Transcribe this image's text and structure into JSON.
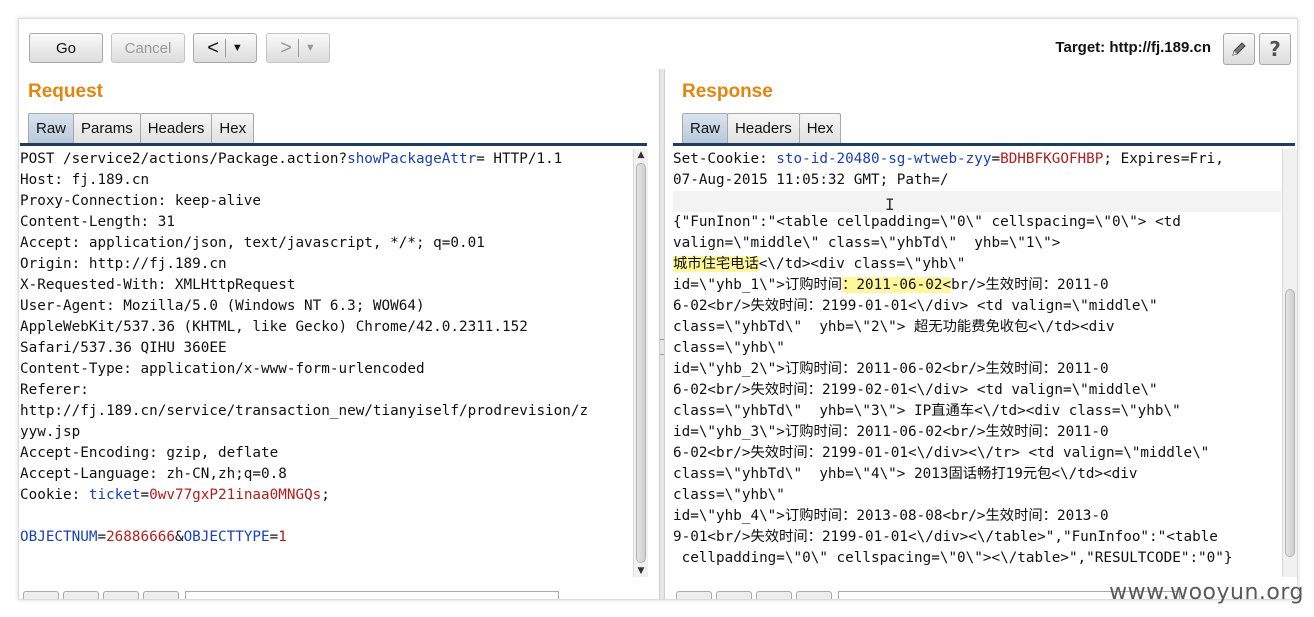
{
  "toolbar": {
    "go_label": "Go",
    "cancel_label": "Cancel",
    "back_glyph": "<",
    "forward_glyph": ">",
    "dropdown_glyph": "▼",
    "target_label": "Target: http://fj.189.cn",
    "edit_icon": "pencil-icon",
    "help_label": "?"
  },
  "request": {
    "title": "Request",
    "tabs": [
      "Raw",
      "Params",
      "Headers",
      "Hex"
    ],
    "active_tab": "Raw",
    "lines": [
      [
        {
          "t": "POST /service2/actions/Package.action?"
        },
        {
          "t": "showPackageAttr",
          "c": "blue"
        },
        {
          "t": "= HTTP/1.1"
        }
      ],
      [
        {
          "t": "Host: fj.189.cn"
        }
      ],
      [
        {
          "t": "Proxy-Connection: keep-alive"
        }
      ],
      [
        {
          "t": "Content-Length: 31"
        }
      ],
      [
        {
          "t": "Accept: application/json, text/javascript, */*; q=0.01"
        }
      ],
      [
        {
          "t": "Origin: http://fj.189.cn"
        }
      ],
      [
        {
          "t": "X-Requested-With: XMLHttpRequest"
        }
      ],
      [
        {
          "t": "User-Agent: Mozilla/5.0 (Windows NT 6.3; WOW64)"
        }
      ],
      [
        {
          "t": "AppleWebKit/537.36 (KHTML, like Gecko) Chrome/42.0.2311.152"
        }
      ],
      [
        {
          "t": "Safari/537.36 QIHU 360EE"
        }
      ],
      [
        {
          "t": "Content-Type: application/x-www-form-urlencoded"
        }
      ],
      [
        {
          "t": "Referer:"
        }
      ],
      [
        {
          "t": "http://fj.189.cn/service/transaction_new/tianyiself/prodrevision/z"
        }
      ],
      [
        {
          "t": "yyw.jsp"
        }
      ],
      [
        {
          "t": "Accept-Encoding: gzip, deflate"
        }
      ],
      [
        {
          "t": "Accept-Language: zh-CN,zh;q=0.8"
        }
      ],
      [
        {
          "t": "Cookie: "
        },
        {
          "t": "ticket",
          "c": "blue"
        },
        {
          "t": "="
        },
        {
          "t": "0wv77gxP21inaa0MNGQs",
          "c": "red"
        },
        {
          "t": ";"
        }
      ],
      [
        {
          "t": ""
        }
      ],
      [
        {
          "t": "OBJECTNUM",
          "c": "blue"
        },
        {
          "t": "="
        },
        {
          "t": "26886666",
          "c": "red"
        },
        {
          "t": "&"
        },
        {
          "t": "OBJECTTYPE",
          "c": "blue"
        },
        {
          "t": "="
        },
        {
          "t": "1",
          "c": "red"
        }
      ]
    ]
  },
  "response": {
    "title": "Response",
    "tabs": [
      "Raw",
      "Headers",
      "Hex"
    ],
    "active_tab": "Raw",
    "lines": [
      [
        {
          "t": "Set-Cookie: "
        },
        {
          "t": "sto-id-20480-sg-wtweb-zyy",
          "c": "blue"
        },
        {
          "t": "="
        },
        {
          "t": "BDHBFKGOFHBP",
          "c": "red"
        },
        {
          "t": "; Expires=Fri,"
        }
      ],
      [
        {
          "t": "07-Aug-2015 11:05:32 GMT; Path=/"
        }
      ],
      [
        {
          "t": ""
        }
      ],
      [
        {
          "t": "{\"FunInon\":\"<table cellpadding=\\\"0\\\" cellspacing=\\\"0\\\"> <td"
        }
      ],
      [
        {
          "t": "valign=\\\"middle\\\" class=\\\"yhbTd\\\"  yhb=\\\"1\\\">"
        }
      ],
      [
        {
          "t": "城市住宅电话",
          "c": "hl"
        },
        {
          "t": "<\\/td><div class=\\\"yhb\\\""
        }
      ],
      [
        {
          "t": "id=\\\"yhb_1\\\">订购时间"
        },
        {
          "t": "：2011-06-02<",
          "c": "hl"
        },
        {
          "t": "br/>生效时间：2011-0"
        }
      ],
      [
        {
          "t": "6-02<br/>失效时间：2199-01-01<\\/div> <td valign=\\\"middle\\\""
        }
      ],
      [
        {
          "t": "class=\\\"yhbTd\\\"  yhb=\\\"2\\\"> 超无功能费免收包<\\/td><div"
        }
      ],
      [
        {
          "t": "class=\\\"yhb\\\""
        }
      ],
      [
        {
          "t": "id=\\\"yhb_2\\\">订购时间：2011-06-02<br/>生效时间：2011-0"
        }
      ],
      [
        {
          "t": "6-02<br/>失效时间：2199-02-01<\\/div> <td valign=\\\"middle\\\""
        }
      ],
      [
        {
          "t": "class=\\\"yhbTd\\\"  yhb=\\\"3\\\"> IP直通车<\\/td><div class=\\\"yhb\\\""
        }
      ],
      [
        {
          "t": "id=\\\"yhb_3\\\">订购时间：2011-06-02<br/>生效时间：2011-0"
        }
      ],
      [
        {
          "t": "6-02<br/>失效时间：2199-01-01<\\/div><\\/tr> <td valign=\\\"middle\\\""
        }
      ],
      [
        {
          "t": "class=\\\"yhbTd\\\"  yhb=\\\"4\\\"> 2013固话畅打19元包<\\/td><div"
        }
      ],
      [
        {
          "t": "class=\\\"yhb\\\""
        }
      ],
      [
        {
          "t": "id=\\\"yhb_4\\\">订购时间：2013-08-08<br/>生效时间：2013-0"
        }
      ],
      [
        {
          "t": "9-01<br/>失效时间：2199-01-01<\\/div><\\/table>\",\"FunInfoo\":\"<table"
        }
      ],
      [
        {
          "t": " cellpadding=\\\"0\\\" cellspacing=\\\"0\\\"><\\/table>\",\"RESULTCODE\":\"0\"}"
        }
      ]
    ]
  },
  "watermark": "www.wooyun.org"
}
